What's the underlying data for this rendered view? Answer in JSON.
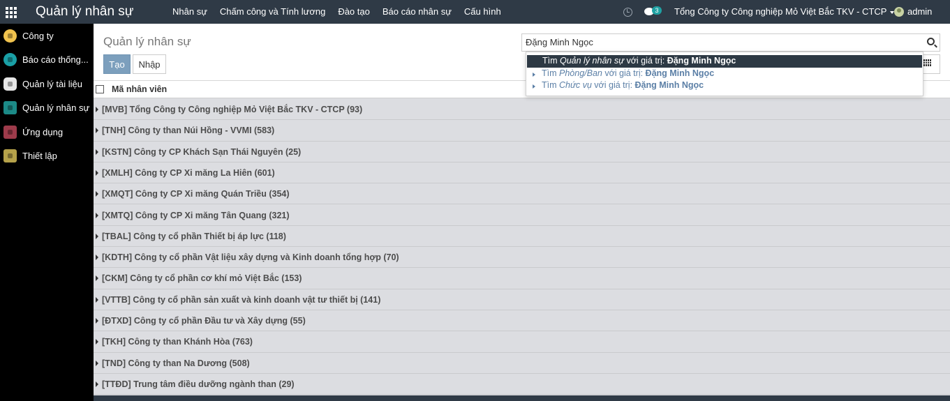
{
  "app": {
    "title": "Quản lý nhân sự"
  },
  "topmenu": [
    "Nhân sự",
    "Chấm công và Tính lương",
    "Đào tạo",
    "Báo cáo nhân sự",
    "Cấu hình"
  ],
  "systray": {
    "chat_count": "3",
    "company": "Tổng Công ty Công nghiệp Mỏ Việt Bắc TKV - CTCP",
    "user": "admin"
  },
  "sidebar": [
    {
      "label": "Công ty",
      "icon": "company-icon"
    },
    {
      "label": "Báo cáo thống...",
      "icon": "report-icon"
    },
    {
      "label": "Quản lý tài liệu",
      "icon": "document-icon"
    },
    {
      "label": "Quản lý nhân sự",
      "icon": "employees-icon"
    },
    {
      "label": "Ứng dụng",
      "icon": "apps-icon"
    },
    {
      "label": "Thiết lập",
      "icon": "settings-icon"
    }
  ],
  "panel": {
    "breadcrumb": "Quản lý nhân sự",
    "create_label": "Tạo",
    "import_label": "Nhập",
    "search_value": "Đặng Minh Ngọc"
  },
  "autocomplete": [
    {
      "prefix": "Tìm ",
      "field": "Quản lý nhân sự",
      "middle": " với giá trị: ",
      "value": "Đặng Minh Ngọc"
    },
    {
      "prefix": "Tìm ",
      "field": "Phòng/Ban",
      "middle": " với giá trị: ",
      "value": "Đặng Minh Ngọc"
    },
    {
      "prefix": "Tìm ",
      "field": "Chức vụ",
      "middle": " với giá trị: ",
      "value": "Đặng Minh Ngọc"
    }
  ],
  "list": {
    "column_header": "Mã nhân viên",
    "groups": [
      "[MVB] Tổng Công ty Công nghiệp Mỏ Việt Bắc TKV - CTCP (93)",
      "[TNH] Công ty than Núi Hồng - VVMI (583)",
      "[KSTN] Công ty CP Khách Sạn Thái Nguyên (25)",
      "[XMLH] Công ty CP Xi măng La Hiên (601)",
      "[XMQT] Công ty CP Xi măng Quán Triều (354)",
      "[XMTQ] Công ty CP Xi măng Tân Quang (321)",
      "[TBAL] Công ty cổ phần Thiết bị áp lực (118)",
      "[KDTH] Công ty cổ phần Vật liệu xây dựng và Kinh doanh tổng hợp (70)",
      "[CKM] Công ty cổ phần cơ khí mỏ Việt Bắc (153)",
      "[VTTB] Công ty cổ phần sản xuất và kinh doanh vật tư thiết bị (141)",
      "[ĐTXD] Công ty cổ phần Đầu tư và Xây dựng (55)",
      "[TKH] Công ty than Khánh Hòa (763)",
      "[TND] Công ty than Na Dương (508)",
      "[TTĐD] Trung tâm điều dưỡng ngành than (29)"
    ]
  }
}
